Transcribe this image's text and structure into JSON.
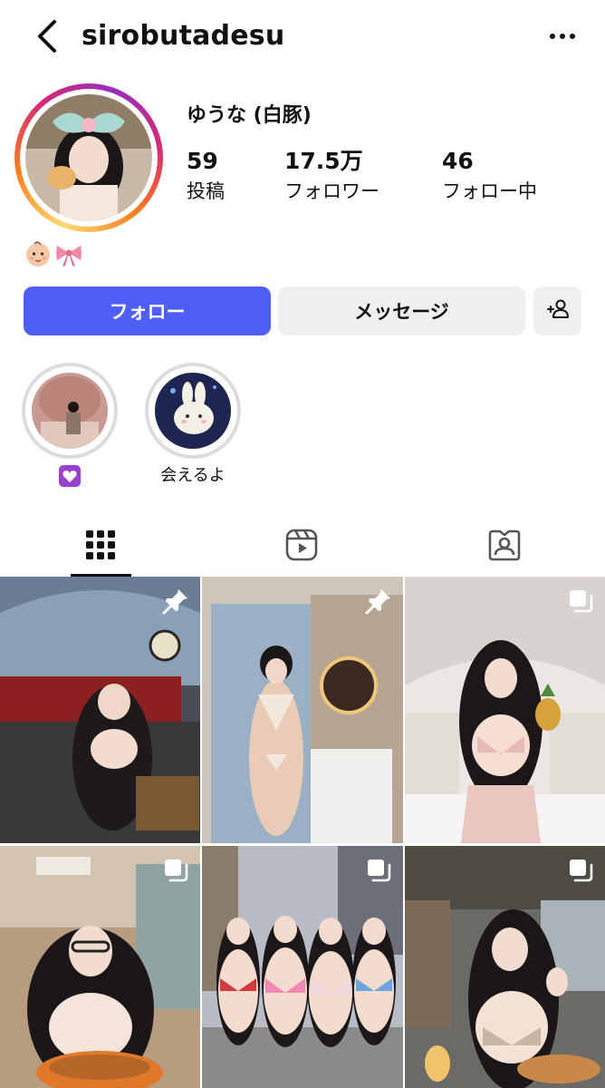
{
  "header": {
    "username": "sirobutadesu",
    "back_icon": "chevron-left-icon",
    "more_icon": "ellipsis-icon"
  },
  "profile": {
    "display_name": "ゆうな (白豚)",
    "stats": [
      {
        "value": "59",
        "label": "投稿"
      },
      {
        "value": "17.5万",
        "label": "フォロワー"
      },
      {
        "value": "46",
        "label": "フォロー中"
      }
    ],
    "bio_emoji": "👶🏻🎀"
  },
  "actions": {
    "follow_label": "フォロー",
    "message_label": "メッセージ",
    "add_user_icon": "person-add-icon",
    "follow_color": "#4f5ef4"
  },
  "highlights": [
    {
      "label": "💟"
    },
    {
      "label": "会えるよ"
    }
  ],
  "tabs": [
    {
      "name": "posts-grid",
      "icon": "grid-icon",
      "active": true
    },
    {
      "name": "reels",
      "icon": "reels-icon",
      "active": false
    },
    {
      "name": "tagged",
      "icon": "tagged-icon",
      "active": false
    }
  ],
  "posts": [
    {
      "badge": "pin-icon",
      "scene": "train-station"
    },
    {
      "badge": "pin-icon",
      "scene": "bathroom-mirror"
    },
    {
      "badge": "carousel-icon",
      "scene": "bed-pineapple"
    },
    {
      "badge": "carousel-icon",
      "scene": "cafe-bowl"
    },
    {
      "badge": "carousel-icon",
      "scene": "rooftop-group"
    },
    {
      "badge": "carousel-icon",
      "scene": "cafe-pancakes"
    }
  ]
}
